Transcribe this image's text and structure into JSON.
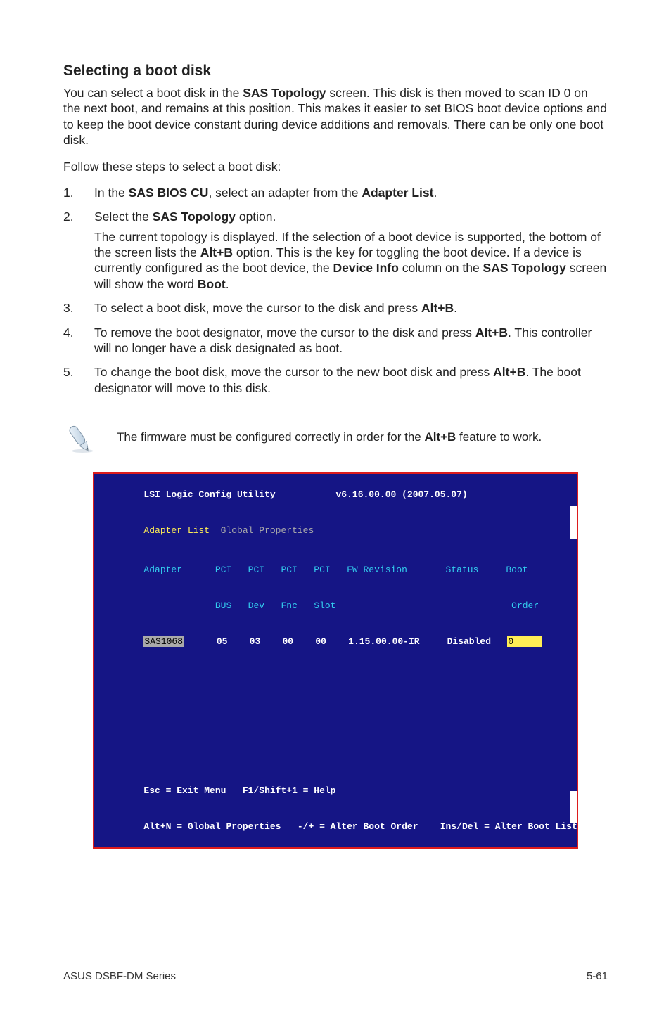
{
  "title": "Selecting a boot disk",
  "lead": "You can select a boot disk in the SAS Topology screen. This disk is then moved to scan ID 0 on the next boot, and remains at this position. This makes it easier to set BIOS boot device options and to keep the boot device constant during device additions and removals. There can be only one boot disk.",
  "lead_bold": {
    "sas_topology": "SAS Topology"
  },
  "follow": "Follow these steps to select a boot disk:",
  "steps": {
    "s1": {
      "num": "1.",
      "pre": "In the ",
      "b1": "SAS BIOS CU",
      "mid": ", select an adapter from the ",
      "b2": "Adapter List",
      "post": "."
    },
    "s2": {
      "num": "2.",
      "line1_pre": "Select the ",
      "line1_b": "SAS Topology",
      "line1_post": " option.",
      "para_pre": "The current topology is displayed. If the selection of a boot device is supported, the bottom of the screen lists the ",
      "para_b1": "Alt+B",
      "para_mid1": " option. This is the key for toggling the boot device. If a device is currently configured as the boot device, the ",
      "para_b2": "Device Info",
      "para_mid2": " column on the ",
      "para_b3": "SAS Topology",
      "para_mid3": " screen will show the word ",
      "para_b4": "Boot",
      "para_post": "."
    },
    "s3": {
      "num": "3.",
      "pre": "To select a boot disk, move the cursor to the disk and press ",
      "b1": "Alt+B",
      "post": "."
    },
    "s4": {
      "num": "4.",
      "pre": "To remove the boot designator, move the cursor to the disk and press ",
      "b1": "Alt+B",
      "post": ". This controller will no longer have a disk designated as boot."
    },
    "s5": {
      "num": "5.",
      "pre": "To change the boot disk, move the cursor to the new boot disk and press ",
      "b1": "Alt+B",
      "post": ". The boot designator will move to this disk."
    }
  },
  "note": {
    "pre": "The firmware must be configured correctly in order for the ",
    "b1": "Alt+B",
    "post": " feature to work."
  },
  "bios": {
    "title_left": "LSI Logic Config Utility",
    "title_right": "v6.16.00.00 (2007.05.07)",
    "tab1": "Adapter List",
    "tab2": "Global Properties",
    "hdr": {
      "adapter": "Adapter",
      "pci_bus": "PCI",
      "pci_bus2": "BUS",
      "pci_dev": "PCI",
      "pci_dev2": "Dev",
      "pci_fnc": "PCI",
      "pci_fnc2": "Fnc",
      "pci_slot": "PCI",
      "pci_slot2": "Slot",
      "fw": "FW Revision",
      "status": "Status",
      "boot": "Boot",
      "boot2": "Order"
    },
    "row": {
      "adapter": "SAS1068",
      "bus": "05",
      "dev": "03",
      "fnc": "00",
      "slot": "00",
      "fw": "1.15.00.00-IR",
      "status": "Disabled",
      "boot": "0"
    },
    "help1_left": "Esc = Exit Menu",
    "help1_right": "F1/Shift+1 = Help",
    "help2_a": "Alt+N = Global Properties",
    "help2_b": "-/+ = Alter Boot Order",
    "help2_c": "Ins/Del = Alter Boot List"
  },
  "footer": {
    "left": "ASUS DSBF-DM Series",
    "right": "5-61"
  }
}
